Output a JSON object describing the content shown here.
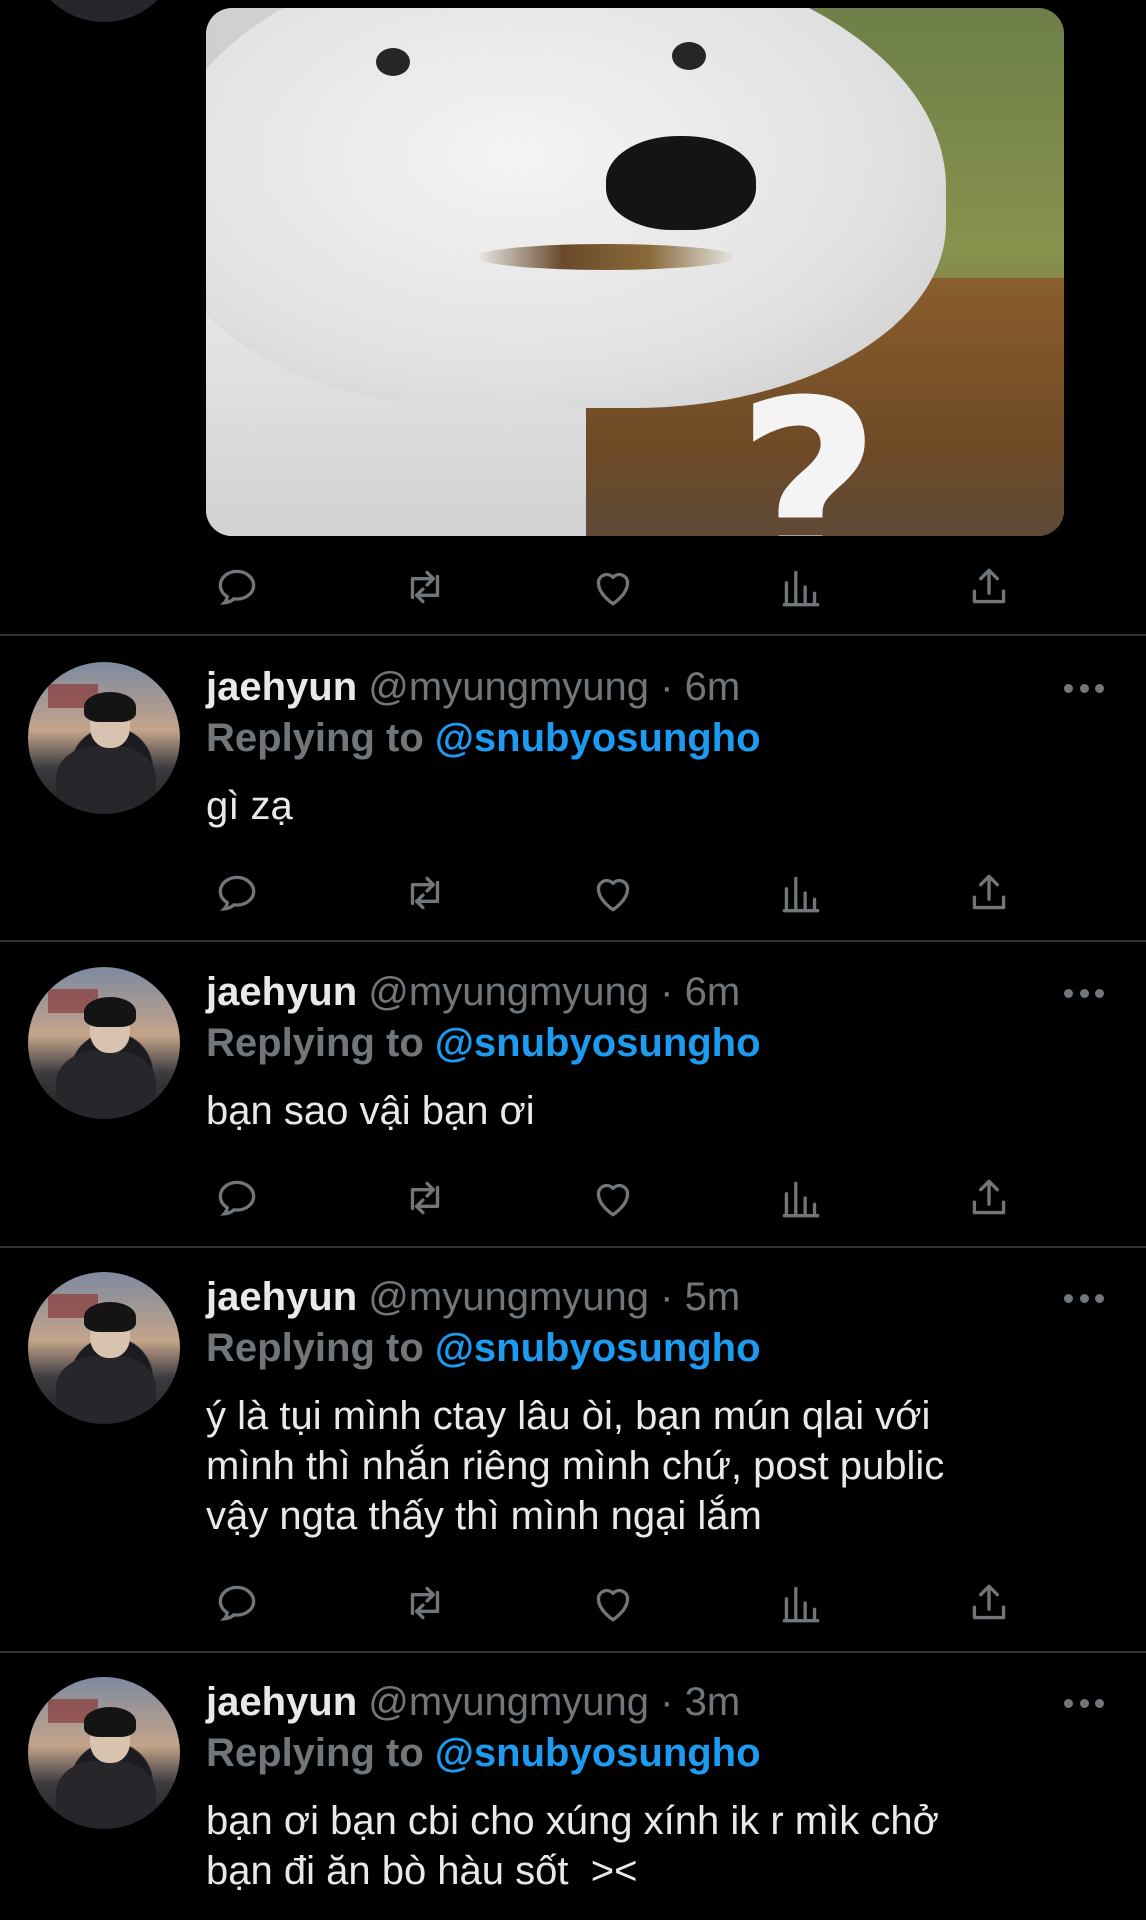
{
  "colors": {
    "background": "#000000",
    "text": "#e7e9ea",
    "secondary": "#71767b",
    "accent": "#1d9bf0",
    "divider": "#2f3336"
  },
  "media": {
    "overlay_glyph": "?"
  },
  "tweets": [
    {
      "name": "jaehyun",
      "handle": "@myungmyung",
      "sep": "·",
      "time": "6m",
      "replying_label": "Replying to",
      "reply_to": "@snubyosungho",
      "text": "gì zạ"
    },
    {
      "name": "jaehyun",
      "handle": "@myungmyung",
      "sep": "·",
      "time": "6m",
      "replying_label": "Replying to",
      "reply_to": "@snubyosungho",
      "text": "bạn sao vậi bạn ơi"
    },
    {
      "name": "jaehyun",
      "handle": "@myungmyung",
      "sep": "·",
      "time": "5m",
      "replying_label": "Replying to",
      "reply_to": "@snubyosungho",
      "text_lines": [
        "ý là tụi mình ctay lâu òi, bạn mún qlai với",
        "mình thì nhắn riêng mình chứ, post public",
        "vậy ngta thấy thì mình ngại lắm"
      ]
    },
    {
      "name": "jaehyun",
      "handle": "@myungmyung",
      "sep": "·",
      "time": "3m",
      "replying_label": "Replying to",
      "reply_to": "@snubyosungho",
      "text_lines": [
        "bạn ơi bạn cbi cho xúng xính ik r mìk chở",
        "bạn đi ăn bò hàu sốt  ><"
      ]
    }
  ],
  "action_icons": [
    "reply-icon",
    "retweet-icon",
    "like-icon",
    "analytics-icon",
    "share-icon"
  ]
}
